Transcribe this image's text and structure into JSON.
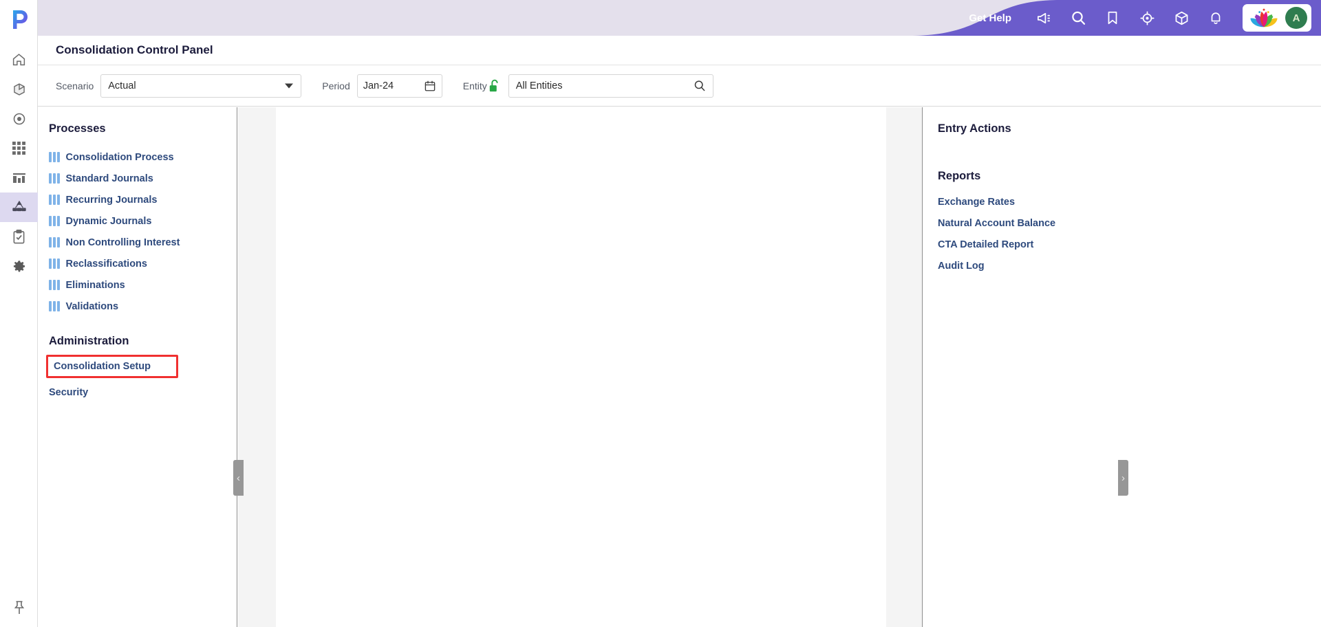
{
  "app": {
    "logo_icon": "p-logo-icon",
    "pin_icon": "pin-icon"
  },
  "rail": {
    "items": [
      {
        "icon": "home-icon",
        "name": "home"
      },
      {
        "icon": "cube-icon",
        "name": "models"
      },
      {
        "icon": "target-dot-icon",
        "name": "targets"
      },
      {
        "icon": "grid-icon",
        "name": "grid"
      },
      {
        "icon": "bar-chart-icon",
        "name": "reports"
      },
      {
        "icon": "hierarchy-icon",
        "name": "consolidation",
        "active": true
      },
      {
        "icon": "clipboard-check-icon",
        "name": "tasks"
      },
      {
        "icon": "gear-icon",
        "name": "settings"
      }
    ]
  },
  "header": {
    "get_help_label": "Get Help",
    "icons": [
      {
        "icon": "megaphone-icon",
        "name": "announcements"
      },
      {
        "icon": "search-icon",
        "name": "search"
      },
      {
        "icon": "bookmark-icon",
        "name": "bookmarks"
      },
      {
        "icon": "target-icon",
        "name": "navigator"
      },
      {
        "icon": "box-icon",
        "name": "apps"
      },
      {
        "icon": "bell-icon",
        "name": "notifications"
      }
    ],
    "brand_logo_icon": "lotus-logo-icon",
    "avatar_initial": "A",
    "band_color": "#E4E0EC",
    "accent_color": "#6B5CCB"
  },
  "page": {
    "title": "Consolidation Control Panel"
  },
  "filters": {
    "scenario": {
      "label": "Scenario",
      "value": "Actual",
      "placeholder": "Select scenario"
    },
    "period": {
      "label": "Period",
      "value": "Jan-24",
      "calendar_icon": "calendar-icon"
    },
    "entity": {
      "label": "Entity",
      "value": "All Entities",
      "placeholder": "Search entities",
      "lock_icon": "unlock-icon",
      "lock_color": "#27A745",
      "search_icon": "search-icon"
    }
  },
  "left_panel": {
    "processes_title": "Processes",
    "processes": [
      {
        "label": "Consolidation Process"
      },
      {
        "label": "Standard Journals"
      },
      {
        "label": "Recurring Journals"
      },
      {
        "label": "Dynamic Journals"
      },
      {
        "label": "Non Controlling Interest"
      },
      {
        "label": "Reclassifications"
      },
      {
        "label": "Eliminations"
      },
      {
        "label": "Validations"
      }
    ],
    "administration_title": "Administration",
    "administration": [
      {
        "label": "Consolidation Setup",
        "highlighted": true
      },
      {
        "label": "Security",
        "highlighted": false
      }
    ],
    "collapse_icon": "chevron-left-icon"
  },
  "right_panel": {
    "entry_actions_title": "Entry Actions",
    "reports_title": "Reports",
    "reports": [
      {
        "label": "Exchange Rates"
      },
      {
        "label": "Natural Account Balance"
      },
      {
        "label": "CTA Detailed Report"
      },
      {
        "label": "Audit Log"
      }
    ],
    "expand_icon": "chevron-right-icon"
  },
  "colors": {
    "link": "#2E4A7D",
    "bar_icon": "#7FB3E8",
    "highlight_border": "#F03030",
    "rail_active": "#DDD9F0"
  }
}
